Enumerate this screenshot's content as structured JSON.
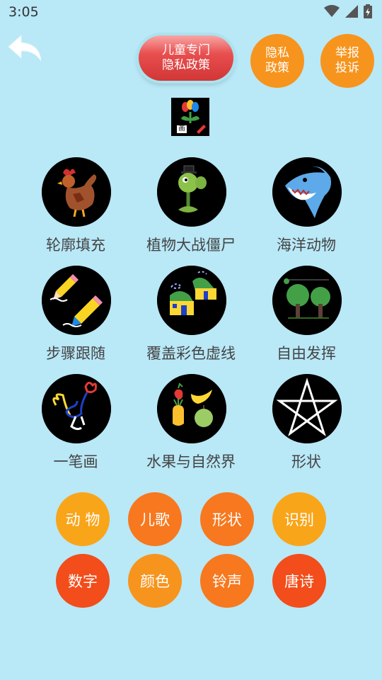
{
  "status": {
    "time": "3:05"
  },
  "header": {
    "privacy_kids_line1": "儿童专门",
    "privacy_kids_line2": "隐私政策",
    "privacy_line1": "隐私",
    "privacy_line2": "政策",
    "report_line1": "举报",
    "report_line2": "投诉",
    "logo_badge": "画"
  },
  "categories": [
    {
      "label": "轮廓填充",
      "icon": "rooster-icon"
    },
    {
      "label": "植物大战僵尸",
      "icon": "peashooter-icon"
    },
    {
      "label": "海洋动物",
      "icon": "shark-icon"
    },
    {
      "label": "步骤跟随",
      "icon": "pencil-icon"
    },
    {
      "label": "覆盖彩色虚线",
      "icon": "house-icon"
    },
    {
      "label": "自由发挥",
      "icon": "trees-icon"
    },
    {
      "label": "一笔画",
      "icon": "line-rooster-icon"
    },
    {
      "label": "水果与自然界",
      "icon": "fruits-icon"
    },
    {
      "label": "形状",
      "icon": "star-icon"
    }
  ],
  "chips": [
    {
      "label": "动 物",
      "color": "#f9a51a"
    },
    {
      "label": "儿歌",
      "color": "#f7781e"
    },
    {
      "label": "形状",
      "color": "#f7781e"
    },
    {
      "label": "识别",
      "color": "#f9a51a"
    },
    {
      "label": "数字",
      "color": "#f24d1a"
    },
    {
      "label": "颜色",
      "color": "#f7941d"
    },
    {
      "label": "铃声",
      "color": "#f7781e"
    },
    {
      "label": "唐诗",
      "color": "#f24d1a"
    }
  ]
}
